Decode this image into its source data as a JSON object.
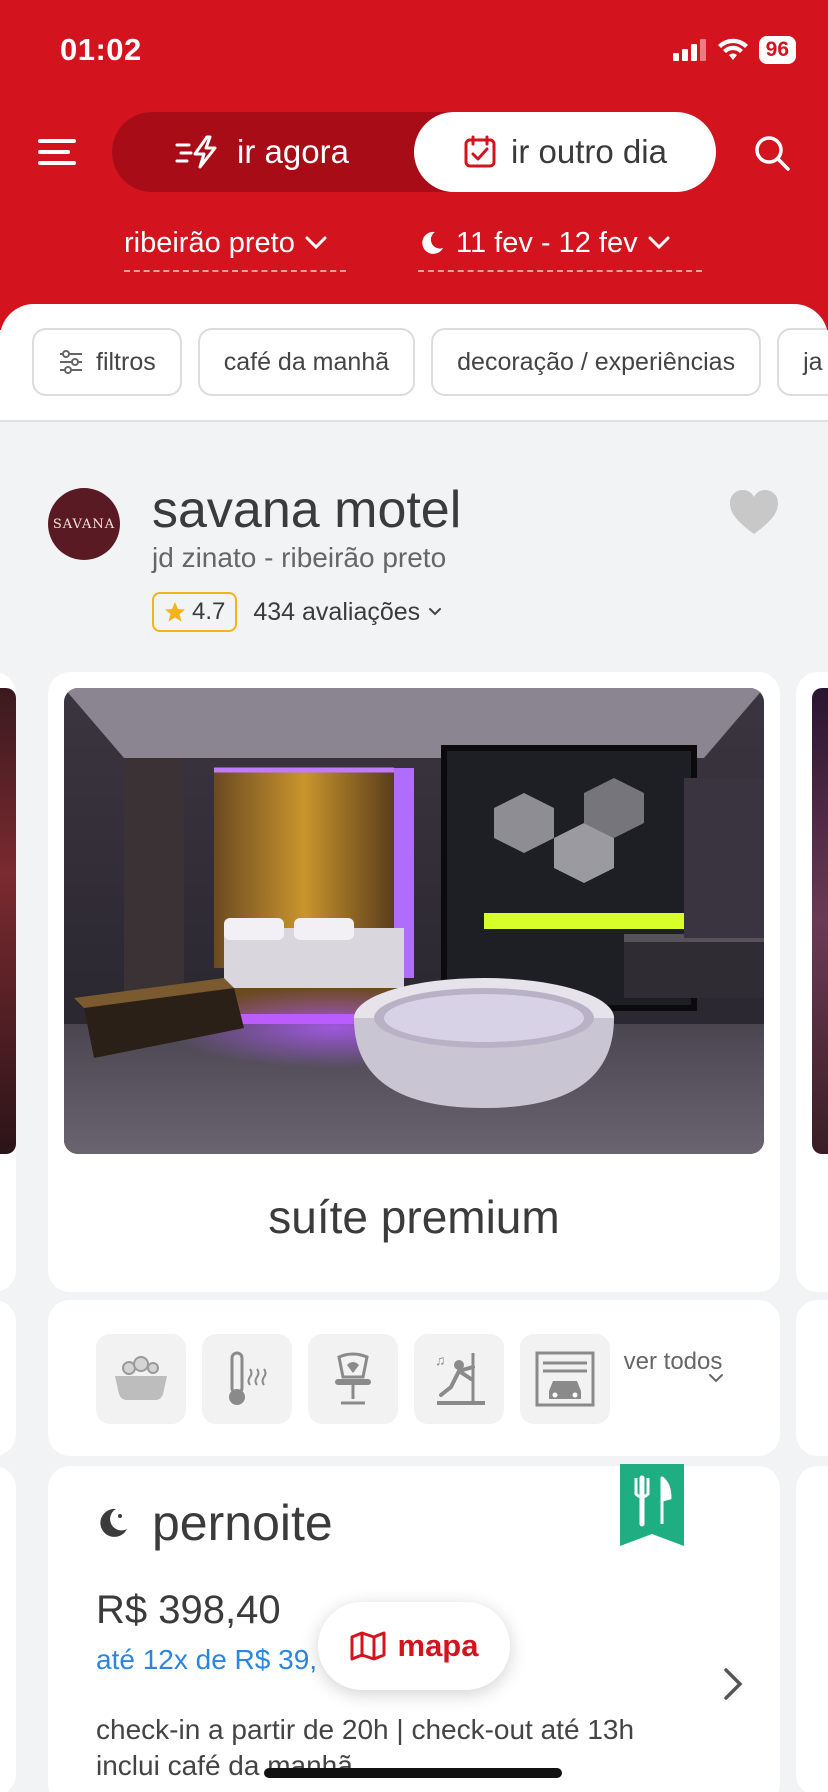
{
  "status_bar": {
    "time": "01:02",
    "battery": "96"
  },
  "header": {
    "mode_now_label": "ir agora",
    "mode_other_label": "ir outro dia",
    "city": "ribeirão preto",
    "dates": "11 fev - 12 fev"
  },
  "filters": [
    "filtros",
    "café da manhã",
    "decoração / experiências",
    "ja"
  ],
  "motel": {
    "logo_text": "SAVANA",
    "name": "savana motel",
    "location": "jd zinato - ribeirão preto",
    "rating": "4.7",
    "reviews": "434 avaliações"
  },
  "suite": {
    "name": "suíte premium"
  },
  "amenities": {
    "icons": [
      "bathtub-icon",
      "sauna-icon",
      "erotic-chair-icon",
      "pole-dance-icon",
      "private-garage-icon"
    ],
    "see_all_label": "ver todos"
  },
  "offer": {
    "period": "pernoite",
    "price": "R$ 398,40",
    "installments": "até 12x de R$ 39,",
    "checkin": "check-in a partir de 20h | check-out até 13h",
    "breakfast": "inclui café da manhã"
  },
  "map_button": {
    "label": "mapa"
  },
  "colors": {
    "brand": "#d3141f",
    "breakfast_badge": "#1fae82",
    "star": "#f3b41b",
    "link": "#2a86e0"
  }
}
